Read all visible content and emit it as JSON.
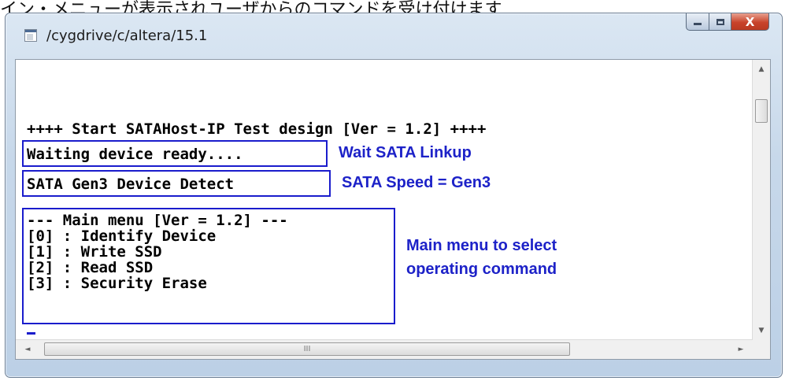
{
  "caption": "イン・メニューが表示されユーザからのコマンドを受け付けます",
  "window": {
    "title": "/cygdrive/c/altera/15.1",
    "minimize_glyph": "",
    "maximize_glyph": "",
    "close_glyph": "X"
  },
  "console": {
    "lines": {
      "start": "++++ Start SATAHost-IP Test design [Ver = 1.2] ++++",
      "waiting": "Waiting device ready....",
      "detect": "SATA Gen3 Device Detect",
      "menu_header": "--- Main menu [Ver = 1.2] ---",
      "menu_0": "[0] : Identify Device",
      "menu_1": "[1] : Write SSD",
      "menu_2": "[2] : Read SSD",
      "menu_3": "[3] : Security Erase"
    },
    "annotations": {
      "linkup": "Wait SATA Linkup",
      "speed": "SATA Speed = Gen3",
      "menu_line1": "Main menu to select",
      "menu_line2": "operating command"
    },
    "annotation_color": "#1d22c8"
  },
  "scrollbars": {
    "up_arrow": "▲",
    "down_arrow": "▼",
    "left_arrow": "◄",
    "right_arrow": "►",
    "h_thumb_grip": "III"
  }
}
